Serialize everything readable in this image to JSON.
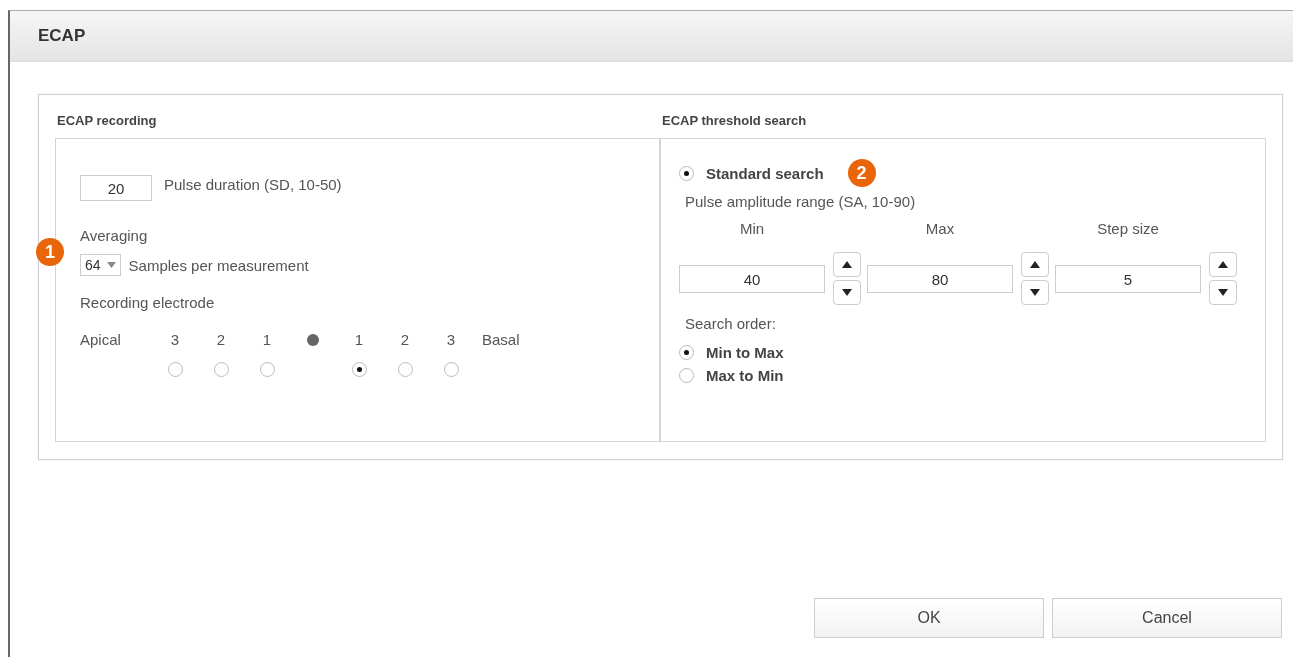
{
  "window": {
    "title": "ECAP"
  },
  "recording": {
    "heading": "ECAP recording",
    "pulse_duration": {
      "value": "20",
      "label": "Pulse duration (SD, 10-50)"
    },
    "badge": "1",
    "averaging_label": "Averaging",
    "samples": {
      "value": "64",
      "label": "Samples per measurement"
    },
    "electrode_label": "Recording electrode",
    "apical_label": "Apical",
    "basal_label": "Basal",
    "apical_electrodes": [
      {
        "label": "3",
        "selected": false
      },
      {
        "label": "2",
        "selected": false
      },
      {
        "label": "1",
        "selected": false
      }
    ],
    "basal_electrodes": [
      {
        "label": "1",
        "selected": true
      },
      {
        "label": "2",
        "selected": false
      },
      {
        "label": "3",
        "selected": false
      }
    ]
  },
  "threshold": {
    "heading": "ECAP threshold search",
    "mode": {
      "label": "Standard search",
      "selected": true
    },
    "badge": "2",
    "range_label": "Pulse amplitude range (SA, 10-90)",
    "spinners": [
      {
        "label": "Min",
        "value": "40"
      },
      {
        "label": "Max",
        "value": "80"
      },
      {
        "label": "Step size",
        "value": "5"
      }
    ],
    "order_label": "Search order:",
    "orders": [
      {
        "label": "Min to Max",
        "selected": true
      },
      {
        "label": "Max to Min",
        "selected": false
      }
    ]
  },
  "buttons": [
    "OK",
    "Cancel"
  ]
}
